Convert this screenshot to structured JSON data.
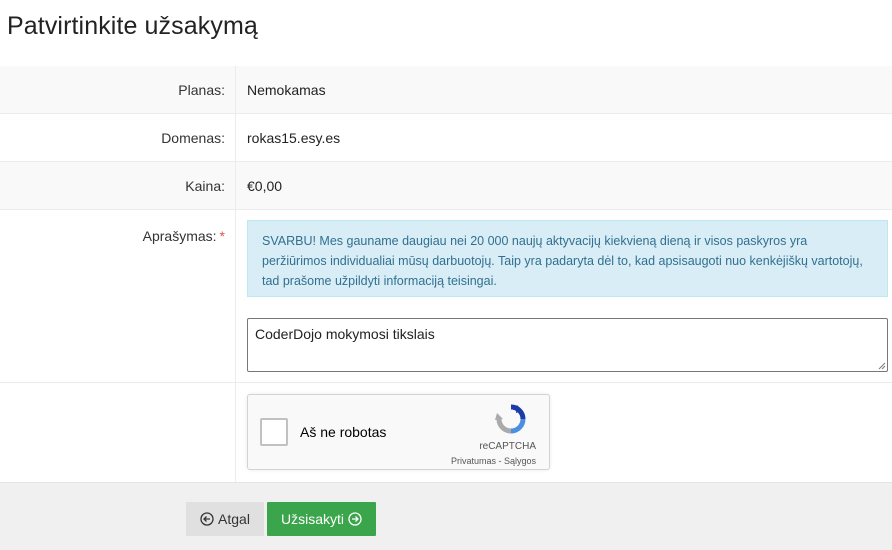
{
  "page": {
    "title": "Patvirtinkite užsakymą"
  },
  "form": {
    "plan": {
      "label": "Planas:",
      "value": "Nemokamas"
    },
    "domain": {
      "label": "Domenas:",
      "value": "rokas15.esy.es"
    },
    "price": {
      "label": "Kaina:",
      "value": "€0,00"
    },
    "description": {
      "label": "Aprašymas:",
      "required_marker": "*",
      "notice": "SVARBU! Mes gauname daugiau nei 20 000 naujų aktyvacijų kiekvieną dieną ir visos paskyros yra peržiūrimos individualiai mūsų darbuotojų. Taip yra padaryta dėl to, kad apsisaugoti nuo kenkėjiškų vartotojų, tad prašome užpildyti informaciją teisingai.",
      "value": "CoderDojo mokymosi tikslais"
    },
    "captcha": {
      "label": "Aš ne robotas",
      "brand": "reCAPTCHA",
      "terms": "Privatumas - Sąlygos",
      "checked": false
    }
  },
  "footer": {
    "back_label": "Atgal",
    "submit_label": "Užsisakyti"
  },
  "colors": {
    "submit": "#3aa54a",
    "notice_bg": "#d9edf7",
    "notice_text": "#31708f",
    "required": "#d9534f"
  },
  "icons": {
    "back": "arrow-left-circle-icon",
    "submit": "arrow-right-circle-icon",
    "captcha": "recaptcha-logo-icon"
  }
}
